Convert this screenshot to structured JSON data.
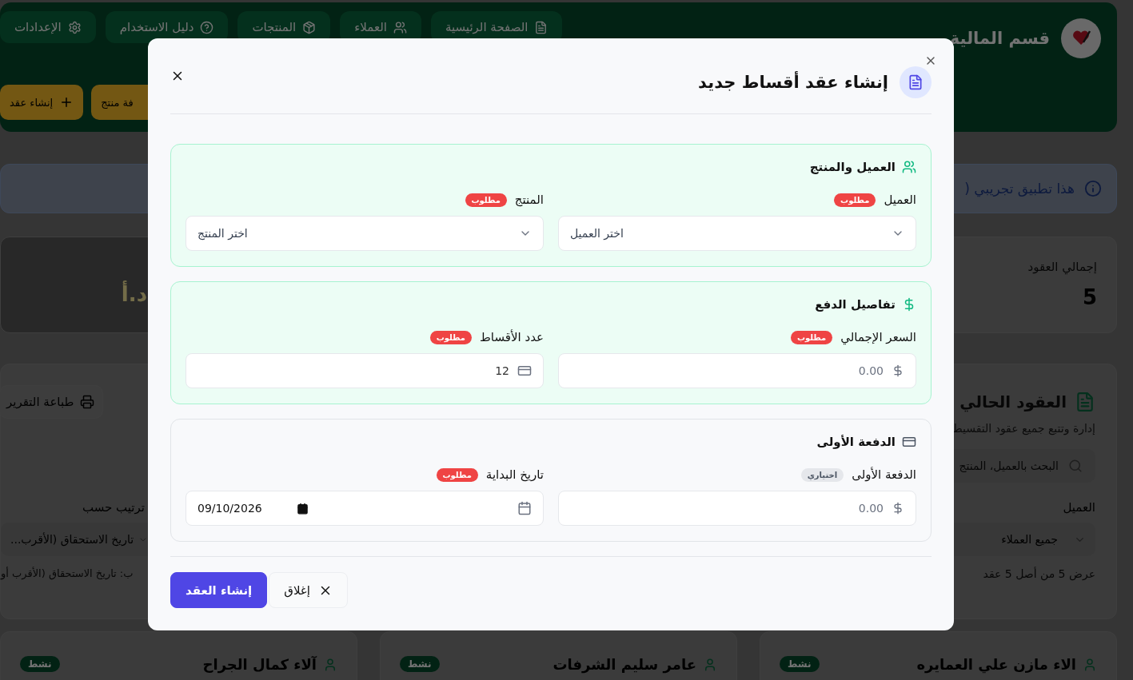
{
  "header": {
    "title": "قسم المالية",
    "nav": [
      {
        "label": "الصفحة الرئيسية"
      },
      {
        "label": "العملاء"
      },
      {
        "label": "المنتجات"
      },
      {
        "label": "دليل الاستخدام"
      },
      {
        "label": "الإعدادات"
      }
    ],
    "actions": [
      {
        "label": "فة منتج"
      },
      {
        "label": "إنشاء عقد"
      }
    ]
  },
  "banner": {
    "text": "هذا تطبيق تجريبي ("
  },
  "stats": [
    {
      "label": "إجمالي العقود",
      "value": "5"
    },
    {
      "value": "د.أ"
    }
  ],
  "contracts": {
    "title": "العقود الحالي",
    "subtitle": "إدارة وتتبع جميع عقود التقسيط",
    "print": "طباعة التقرير",
    "search": {
      "placeholder": "البحث بالعميل، المنتج"
    },
    "filters": [
      {
        "label": "العميل",
        "value": "جميع العملاء"
      },
      {
        "label": "ترتيب حسب",
        "value": "تاريخ الاستحقاق (الأقرب..."
      }
    ],
    "count": "عرض 5 من أصل 5 عقد",
    "sort_note": "ب: تاريخ الاستحقاق (الأقرب أو",
    "cards": [
      {
        "name": "الاء مازن علي العمايره",
        "status": "نشط"
      },
      {
        "name": "عامر سليم الشرفات",
        "status": "نشط"
      },
      {
        "name": "آلاء كمال الجراح",
        "status": "نشط"
      }
    ]
  },
  "modal": {
    "title": "إنشاء عقد أقساط جديد",
    "sections": [
      {
        "title": "العميل والمنتج",
        "kind": "highlighted",
        "fields": [
          {
            "label": "العميل",
            "badge": {
              "text": "مطلوب",
              "kind": "required"
            },
            "kind": "select",
            "placeholder": "اختر العميل"
          },
          {
            "label": "المنتج",
            "badge": {
              "text": "مطلوب",
              "kind": "required"
            },
            "kind": "select",
            "placeholder": "اختر المنتج"
          }
        ]
      },
      {
        "title": "تفاصيل الدفع",
        "kind": "highlighted",
        "fields": [
          {
            "label": "السعر الإجمالي",
            "badge": {
              "text": "مطلوب",
              "kind": "required"
            },
            "kind": "amount",
            "placeholder": "0.00"
          },
          {
            "label": "عدد الأقساط",
            "badge": {
              "text": "مطلوب",
              "kind": "required"
            },
            "kind": "count",
            "value": "12"
          }
        ]
      },
      {
        "title": "الدفعة الأولى",
        "kind": "plain",
        "fields": [
          {
            "label": "الدفعة الأولى",
            "badge": {
              "text": "اختياري",
              "kind": "optional"
            },
            "kind": "amount",
            "placeholder": "0.00"
          },
          {
            "label": "تاريخ البداية",
            "badge": {
              "text": "مطلوب",
              "kind": "required"
            },
            "kind": "date",
            "value": "09/10/2026"
          }
        ]
      }
    ],
    "buttons": [
      {
        "label": "إغلاق",
        "kind": "secondary"
      },
      {
        "label": "إنشاء العقد",
        "kind": "primary"
      }
    ]
  }
}
